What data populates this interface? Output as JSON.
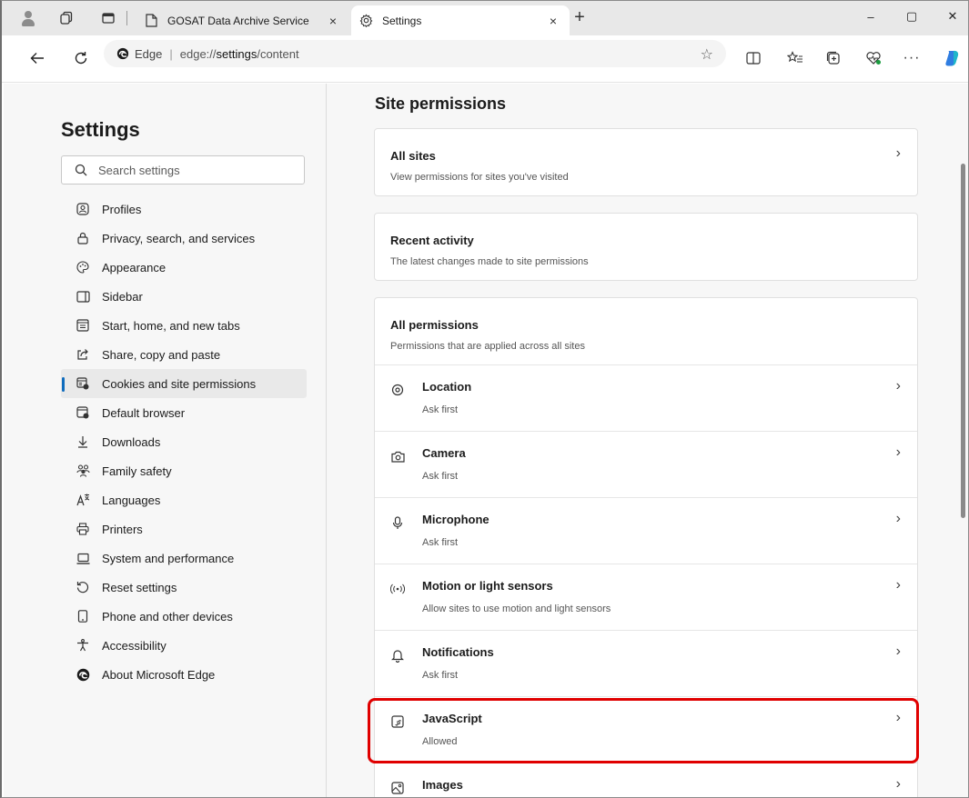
{
  "browser": {
    "tabs": [
      {
        "title": "GOSAT Data Archive Service",
        "close": "×"
      },
      {
        "title": "Settings",
        "close": "×"
      }
    ],
    "new_tab": "+",
    "window": {
      "minimize": "–",
      "maximize": "▢",
      "close": "✕"
    },
    "address": {
      "scheme": "Edge",
      "separator": "|",
      "url_prefix": "edge://",
      "url_bold": "settings",
      "url_suffix": "/content"
    },
    "more": "···"
  },
  "sidebar": {
    "title": "Settings",
    "search_placeholder": "Search settings",
    "items": [
      {
        "label": "Profiles",
        "icon": "profile-icon"
      },
      {
        "label": "Privacy, search, and services",
        "icon": "lock-icon"
      },
      {
        "label": "Appearance",
        "icon": "palette-icon"
      },
      {
        "label": "Sidebar",
        "icon": "sidebar-icon"
      },
      {
        "label": "Start, home, and new tabs",
        "icon": "home-tabs-icon"
      },
      {
        "label": "Share, copy and paste",
        "icon": "share-icon"
      },
      {
        "label": "Cookies and site permissions",
        "icon": "cookies-icon",
        "active": true
      },
      {
        "label": "Default browser",
        "icon": "default-browser-icon"
      },
      {
        "label": "Downloads",
        "icon": "download-icon"
      },
      {
        "label": "Family safety",
        "icon": "family-icon"
      },
      {
        "label": "Languages",
        "icon": "languages-icon"
      },
      {
        "label": "Printers",
        "icon": "printer-icon"
      },
      {
        "label": "System and performance",
        "icon": "laptop-icon"
      },
      {
        "label": "Reset settings",
        "icon": "reset-icon"
      },
      {
        "label": "Phone and other devices",
        "icon": "phone-icon"
      },
      {
        "label": "Accessibility",
        "icon": "accessibility-icon"
      },
      {
        "label": "About Microsoft Edge",
        "icon": "edge-logo-icon"
      }
    ]
  },
  "main": {
    "section_title": "Site permissions",
    "all_sites": {
      "title": "All sites",
      "subtitle": "View permissions for sites you've visited"
    },
    "recent_activity": {
      "title": "Recent activity",
      "subtitle": "The latest changes made to site permissions"
    },
    "all_permissions": {
      "title": "All permissions",
      "subtitle": "Permissions that are applied across all sites",
      "items": [
        {
          "title": "Location",
          "subtitle": "Ask first",
          "icon": "location-icon"
        },
        {
          "title": "Camera",
          "subtitle": "Ask first",
          "icon": "camera-icon"
        },
        {
          "title": "Microphone",
          "subtitle": "Ask first",
          "icon": "microphone-icon"
        },
        {
          "title": "Motion or light sensors",
          "subtitle": "Allow sites to use motion and light sensors",
          "icon": "sensor-icon"
        },
        {
          "title": "Notifications",
          "subtitle": "Ask first",
          "icon": "bell-icon"
        },
        {
          "title": "JavaScript",
          "subtitle": "Allowed",
          "icon": "javascript-icon"
        },
        {
          "title": "Images",
          "subtitle": "",
          "icon": "image-icon"
        }
      ]
    }
  },
  "colors": {
    "accent": "#0f6cbd",
    "highlight": "#e00000"
  }
}
